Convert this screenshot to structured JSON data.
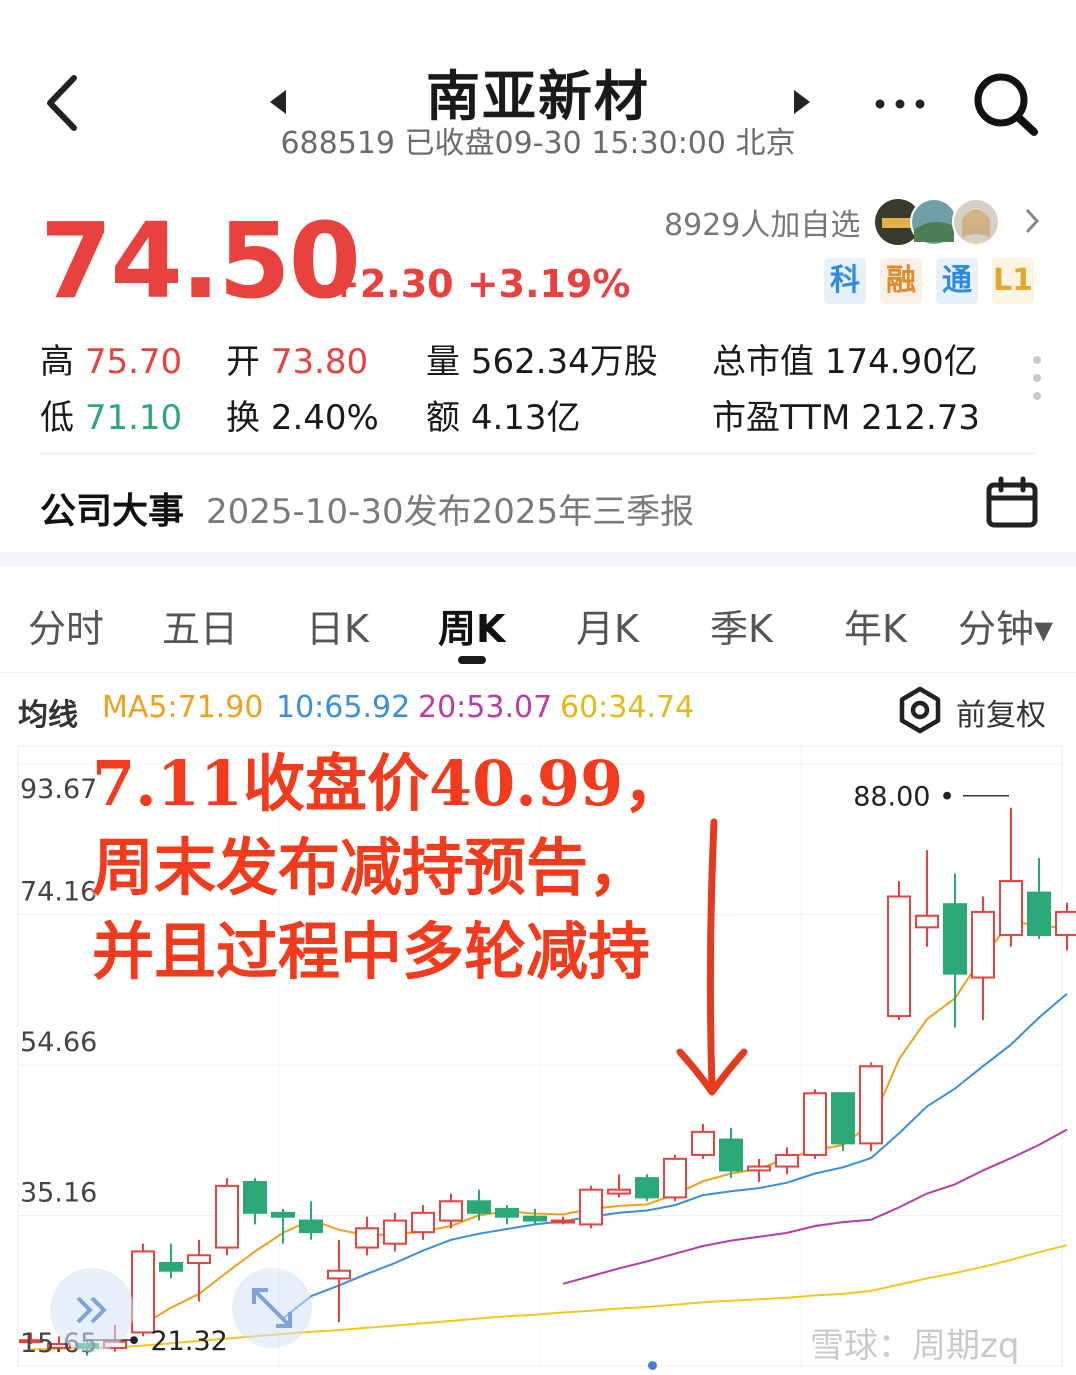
{
  "header": {
    "title": "南亚新材",
    "subtitle": "688519 已收盘09-30 15:30:00 北京"
  },
  "quote": {
    "price": "74.50",
    "change": "+2.30 +3.19%",
    "followers": "8929人加自选",
    "badges": [
      "科",
      "融",
      "通",
      "L1"
    ],
    "stats": {
      "high_label": "高",
      "high_value": "75.70",
      "open_label": "开",
      "open_value": "73.80",
      "volume_label": "量",
      "volume_value": "562.34万股",
      "mktcap_label": "总市值",
      "mktcap_value": "174.90亿",
      "low_label": "低",
      "low_value": "71.10",
      "turnover_label": "换",
      "turnover_value": "2.40%",
      "amount_label": "额",
      "amount_value": "4.13亿",
      "pe_label": "市盈TTM",
      "pe_value": "212.73"
    }
  },
  "event": {
    "label": "公司大事",
    "text": "2025-10-30发布2025年三季报"
  },
  "tabs": [
    {
      "label": "分时",
      "active": false
    },
    {
      "label": "五日",
      "active": false
    },
    {
      "label": "日K",
      "active": false
    },
    {
      "label": "周K",
      "active": true
    },
    {
      "label": "月K",
      "active": false
    },
    {
      "label": "季K",
      "active": false
    },
    {
      "label": "年K",
      "active": false
    },
    {
      "label": "分钟▾",
      "active": false
    }
  ],
  "ma_legend": {
    "title": "均线",
    "ma5": "MA5:71.90",
    "ma10": "10:65.92",
    "ma20": "20:53.07",
    "ma60": "60:34.74",
    "adjust": "前复权"
  },
  "colors": {
    "up": "#e8413e",
    "down": "#2aa876",
    "ma5": "#f0a01c",
    "ma10": "#3a8fd8",
    "ma20": "#b63da6",
    "ma60": "#f2c81e"
  },
  "annotation": {
    "lines": [
      "7.11收盘价40.99，",
      "周末发布减持预告，",
      "并且过程中多轮减持"
    ]
  },
  "watermark": "雪球：周期zq",
  "chart_data": {
    "type": "candlestick",
    "y_ticks": [
      "93.67",
      "74.16",
      "54.66",
      "35.16",
      "15.65"
    ],
    "ylim": [
      15.65,
      93.67
    ],
    "max_label": "88.00",
    "min_label": "21.32",
    "candles": [
      {
        "o": 19.0,
        "c": 19.0,
        "h": 20.0,
        "l": 18.5
      },
      {
        "o": 18.0,
        "c": 18.5,
        "h": 19.5,
        "l": 17.5
      },
      {
        "o": 18.5,
        "c": 18.0,
        "h": 19.0,
        "l": 17.0
      },
      {
        "o": 18.0,
        "c": 18.8,
        "h": 21.0,
        "l": 17.5
      },
      {
        "o": 20.0,
        "c": 30.5,
        "h": 31.5,
        "l": 19.5
      },
      {
        "o": 29.0,
        "c": 28.0,
        "h": 31.5,
        "l": 27.0
      },
      {
        "o": 29.0,
        "c": 30.0,
        "h": 32.0,
        "l": 24.0
      },
      {
        "o": 31.0,
        "c": 39.0,
        "h": 40.0,
        "l": 30.0
      },
      {
        "o": 39.5,
        "c": 35.5,
        "h": 40.0,
        "l": 34.0
      },
      {
        "o": 35.5,
        "c": 35.0,
        "h": 36.0,
        "l": 31.5
      },
      {
        "o": 34.5,
        "c": 33.0,
        "h": 37.0,
        "l": 32.0
      },
      {
        "o": 27.0,
        "c": 28.0,
        "h": 32.0,
        "l": 21.32
      },
      {
        "o": 31.0,
        "c": 33.5,
        "h": 35.0,
        "l": 30.0
      },
      {
        "o": 31.5,
        "c": 34.5,
        "h": 35.5,
        "l": 30.5
      },
      {
        "o": 33.0,
        "c": 35.5,
        "h": 36.5,
        "l": 32.0
      },
      {
        "o": 34.5,
        "c": 37.0,
        "h": 38.0,
        "l": 33.5
      },
      {
        "o": 37.0,
        "c": 35.5,
        "h": 38.5,
        "l": 34.5
      },
      {
        "o": 36.0,
        "c": 35.0,
        "h": 36.5,
        "l": 34.0
      },
      {
        "o": 35.0,
        "c": 34.5,
        "h": 36.0,
        "l": 34.0
      },
      {
        "o": 34.5,
        "c": 34.5,
        "h": 35.0,
        "l": 34.0
      },
      {
        "o": 34.0,
        "c": 38.5,
        "h": 39.0,
        "l": 33.5
      },
      {
        "o": 38.0,
        "c": 38.5,
        "h": 40.5,
        "l": 37.5
      },
      {
        "o": 40.0,
        "c": 37.5,
        "h": 40.5,
        "l": 37.0
      },
      {
        "o": 37.5,
        "c": 42.5,
        "h": 43.0,
        "l": 37.0
      },
      {
        "o": 43.0,
        "c": 46.0,
        "h": 47.0,
        "l": 42.5
      },
      {
        "o": 45.0,
        "c": 40.99,
        "h": 46.5,
        "l": 40.0
      },
      {
        "o": 41.0,
        "c": 41.5,
        "h": 42.5,
        "l": 39.5
      },
      {
        "o": 41.5,
        "c": 43.0,
        "h": 44.0,
        "l": 40.5
      },
      {
        "o": 43.0,
        "c": 51.0,
        "h": 51.5,
        "l": 42.5
      },
      {
        "o": 51.0,
        "c": 44.5,
        "h": 51.0,
        "l": 43.5
      },
      {
        "o": 44.5,
        "c": 54.5,
        "h": 55.0,
        "l": 43.5
      },
      {
        "o": 61.0,
        "c": 76.5,
        "h": 78.5,
        "l": 60.5
      },
      {
        "o": 72.5,
        "c": 74.0,
        "h": 82.5,
        "l": 70.0
      },
      {
        "o": 75.5,
        "c": 66.5,
        "h": 79.5,
        "l": 59.5
      },
      {
        "o": 66.0,
        "c": 74.5,
        "h": 76.5,
        "l": 60.5
      },
      {
        "o": 71.5,
        "c": 78.5,
        "h": 88.0,
        "l": 70.0
      },
      {
        "o": 77.0,
        "c": 71.5,
        "h": 81.5,
        "l": 71.0
      },
      {
        "o": 71.5,
        "c": 74.5,
        "h": 75.7,
        "l": 69.5
      }
    ],
    "ma5": [
      null,
      null,
      null,
      null,
      21.0,
      23.2,
      25.0,
      27.8,
      30.5,
      32.9,
      34.6,
      33.3,
      32.6,
      32.7,
      33.1,
      33.8,
      35.2,
      35.7,
      35.4,
      35.3,
      36.0,
      36.4,
      36.6,
      37.9,
      39.6,
      40.6,
      41.2,
      42.6,
      43.6,
      44.3,
      47.0,
      55.4,
      60.6,
      63.3,
      68.8,
      73.1,
      72.9,
      72.2
    ],
    "ma10": [
      null,
      null,
      null,
      null,
      null,
      null,
      null,
      null,
      null,
      21.8,
      24.7,
      26.1,
      27.6,
      29.0,
      30.6,
      32.0,
      32.8,
      33.4,
      34.0,
      34.4,
      35.0,
      35.5,
      35.8,
      36.5,
      37.8,
      38.3,
      38.7,
      39.4,
      40.6,
      41.4,
      42.6,
      45.8,
      49.3,
      51.6,
      54.5,
      57.3,
      60.8,
      63.9
    ],
    "ma20": [
      null,
      null,
      null,
      null,
      null,
      null,
      null,
      null,
      null,
      null,
      null,
      null,
      null,
      null,
      null,
      null,
      null,
      null,
      null,
      26.3,
      27.3,
      28.3,
      29.2,
      30.2,
      31.2,
      31.9,
      32.4,
      32.9,
      33.8,
      34.3,
      34.6,
      36.2,
      38.0,
      39.2,
      41.0,
      42.6,
      44.3,
      46.3
    ],
    "ma60": [
      17.8,
      17.9,
      18.0,
      18.1,
      18.3,
      18.6,
      18.9,
      19.2,
      19.5,
      19.8,
      20.1,
      20.3,
      20.6,
      20.9,
      21.2,
      21.5,
      21.8,
      22.1,
      22.3,
      22.6,
      22.8,
      23.1,
      23.3,
      23.6,
      23.9,
      24.1,
      24.3,
      24.5,
      24.8,
      25.0,
      25.4,
      26.2,
      27.0,
      27.7,
      28.5,
      29.4,
      30.4,
      31.3
    ]
  }
}
